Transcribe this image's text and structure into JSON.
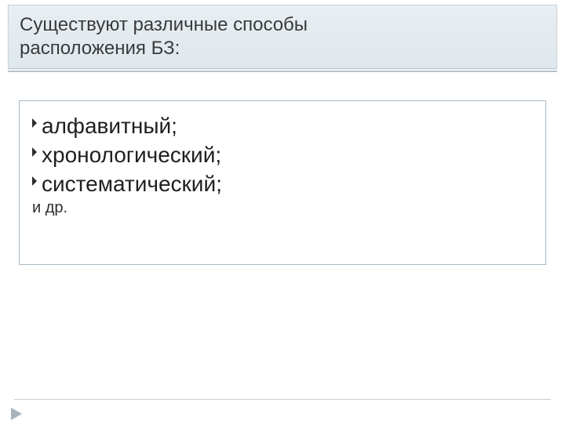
{
  "title": {
    "line1": "Существуют различные способы",
    "line2": "расположения БЗ:"
  },
  "bullets": [
    "алфавитный;",
    " хронологический;",
    "систематический;"
  ],
  "etc_label": "и др."
}
